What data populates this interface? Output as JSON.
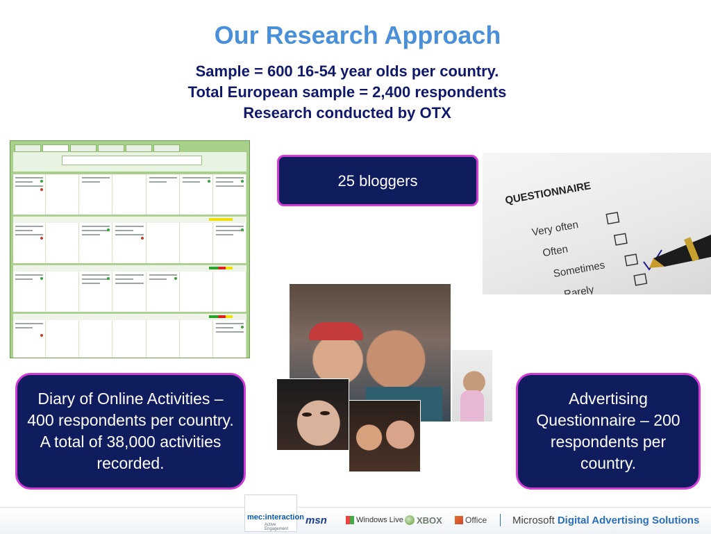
{
  "title": "Our Research Approach",
  "subtitle": [
    "Sample = 600 16-54 year olds per country.",
    "Total European sample = 2,400 respondents",
    "Research conducted by OTX"
  ],
  "callouts": {
    "bloggers": "25 bloggers",
    "diary": "Diary of Online Activities – 400 respondents per country.  A total of 38,000 activities recorded.",
    "advertising": "Advertising Questionnaire – 200 respondents per country."
  },
  "questionnaire_image": {
    "heading": "QUESTIONNAIRE",
    "options": [
      "Very often",
      "Often",
      "Sometimes",
      "Rarely"
    ]
  },
  "footer_logos": {
    "mec_line1": "mec:interaction",
    "mec_line2": "Active Engagement",
    "msn": "msn",
    "windows_live": "Windows Live",
    "xbox": "XBOX",
    "office": "Office",
    "microsoft": "Microsoft",
    "das": "Digital Advertising Solutions"
  },
  "colors": {
    "title": "#4a90d9",
    "subtitle": "#10186a",
    "callout_bg": "#0f1d5e",
    "callout_border": "#d23cd6"
  }
}
